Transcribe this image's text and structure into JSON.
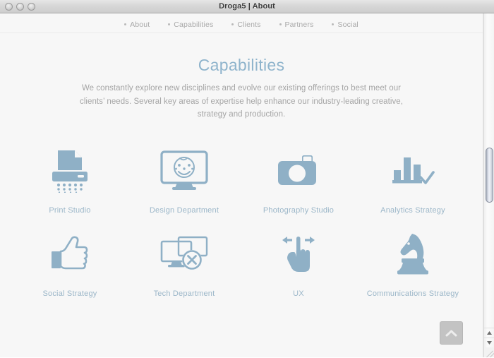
{
  "window": {
    "title": "Droga5 | About",
    "traffic_lights": [
      "close-button",
      "minimize-button",
      "zoom-button"
    ]
  },
  "nav": {
    "items": [
      {
        "label": "About"
      },
      {
        "label": "Capabilities"
      },
      {
        "label": "Clients"
      },
      {
        "label": "Partners"
      },
      {
        "label": "Social"
      }
    ]
  },
  "hero": {
    "heading": "Capabilities",
    "paragraph": "We constantly explore new disciplines and evolve our existing offerings to best meet our clients’ needs. Several key areas of expertise help enhance our industry-leading creative, strategy and production."
  },
  "capabilities": [
    {
      "label": "Print Studio",
      "icon": "printer-shredder-icon"
    },
    {
      "label": "Design Department",
      "icon": "monitor-smiley-icon"
    },
    {
      "label": "Photography Studio",
      "icon": "camera-icon"
    },
    {
      "label": "Analytics Strategy",
      "icon": "bar-chart-check-icon"
    },
    {
      "label": "Social Strategy",
      "icon": "thumbs-up-icon"
    },
    {
      "label": "Tech Department",
      "icon": "monitors-error-icon"
    },
    {
      "label": "UX",
      "icon": "pointing-hand-arrows-icon"
    },
    {
      "label": "Communications Strategy",
      "icon": "chess-knight-icon"
    }
  ],
  "back_to_top": {
    "label": "Back to top",
    "icon": "chevron-up-icon"
  },
  "colors": {
    "accent_blue": "#8fb4cc",
    "icon_blue": "#8fb0c6",
    "body_text": "#a5a5a5",
    "nav_text": "#a9a9a9",
    "page_background": "#f7f7f7"
  }
}
